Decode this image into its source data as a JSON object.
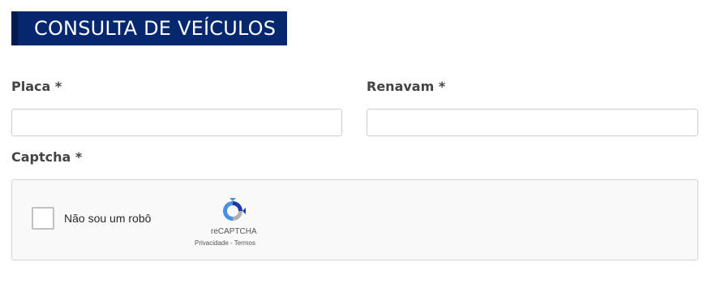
{
  "header": {
    "title": "CONSULTA DE VEÍCULOS"
  },
  "form": {
    "placa": {
      "label": "Placa *",
      "value": ""
    },
    "renavam": {
      "label": "Renavam *",
      "value": ""
    },
    "captcha": {
      "label": "Captcha *",
      "checkbox_label": "Não sou um robô",
      "checked": false,
      "brand": "reCAPTCHA",
      "privacy_link": "Privacidade",
      "separator": " - ",
      "terms_link": "Termos",
      "logo_icon": "recaptcha-logo-icon"
    }
  },
  "colors": {
    "header_bg": "#04276e",
    "header_accent": "#021a4d",
    "recaptcha_blue": "#1c3aa9",
    "recaptcha_light_blue": "#4a90e2",
    "recaptcha_gray": "#b0b0b0"
  }
}
